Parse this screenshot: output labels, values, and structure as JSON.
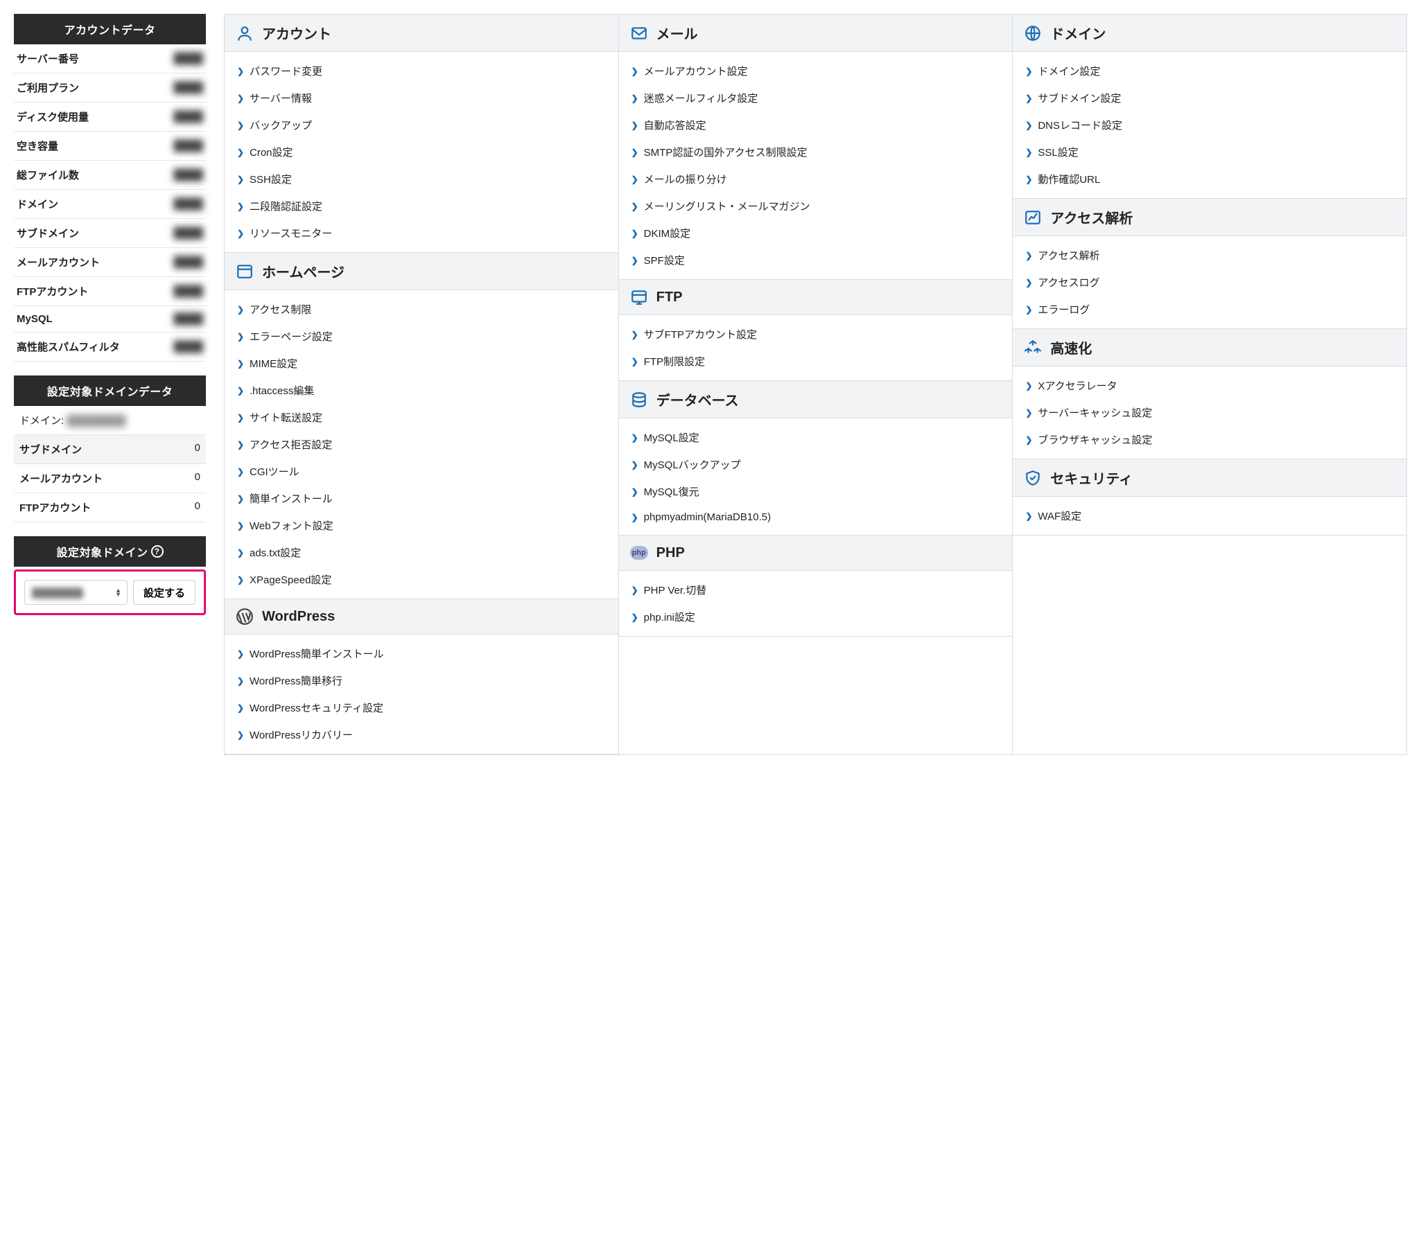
{
  "sidebar": {
    "account_title": "アカウントデータ",
    "stats": [
      {
        "label": "サーバー番号",
        "value": "████"
      },
      {
        "label": "ご利用プラン",
        "value": "████"
      },
      {
        "label": "ディスク使用量",
        "value": "████"
      },
      {
        "label": "空き容量",
        "value": "████"
      },
      {
        "label": "総ファイル数",
        "value": "████"
      },
      {
        "label": "ドメイン",
        "value": "████"
      },
      {
        "label": "サブドメイン",
        "value": "████"
      },
      {
        "label": "メールアカウント",
        "value": "████"
      },
      {
        "label": "FTPアカウント",
        "value": "████"
      },
      {
        "label": "MySQL",
        "value": "████"
      },
      {
        "label": "高性能スパムフィルタ",
        "value": "████"
      }
    ],
    "domain_data_title": "設定対象ドメインデータ",
    "domain_label": "ドメイン:",
    "domain_value": "████████",
    "domain_rows": [
      {
        "label": "サブドメイン",
        "value": "0"
      },
      {
        "label": "メールアカウント",
        "value": "0"
      },
      {
        "label": "FTPアカウント",
        "value": "0"
      }
    ],
    "domain_select_title": "設定対象ドメイン",
    "domain_select_value": "████████",
    "domain_select_button": "設定する"
  },
  "main": {
    "col1": [
      {
        "title": "アカウント",
        "icon": "user",
        "items": [
          "パスワード変更",
          "サーバー情報",
          "バックアップ",
          "Cron設定",
          "SSH設定",
          "二段階認証設定",
          "リソースモニター"
        ]
      },
      {
        "title": "ホームページ",
        "icon": "window",
        "items": [
          "アクセス制限",
          "エラーページ設定",
          "MIME設定",
          ".htaccess編集",
          "サイト転送設定",
          "アクセス拒否設定",
          "CGIツール",
          "簡単インストール",
          "Webフォント設定",
          "ads.txt設定",
          "XPageSpeed設定"
        ]
      },
      {
        "title": "WordPress",
        "icon": "wordpress",
        "items": [
          "WordPress簡単インストール",
          "WordPress簡単移行",
          "WordPressセキュリティ設定",
          "WordPressリカバリー"
        ]
      }
    ],
    "col2": [
      {
        "title": "メール",
        "icon": "mail",
        "items": [
          "メールアカウント設定",
          "迷惑メールフィルタ設定",
          "自動応答設定",
          "SMTP認証の国外アクセス制限設定",
          "メールの振り分け",
          "メーリングリスト・メールマガジン",
          "DKIM設定",
          "SPF設定"
        ]
      },
      {
        "title": "FTP",
        "icon": "ftp",
        "items": [
          "サブFTPアカウント設定",
          "FTP制限設定"
        ]
      },
      {
        "title": "データベース",
        "icon": "database",
        "items": [
          "MySQL設定",
          "MySQLバックアップ",
          "MySQL復元",
          "phpmyadmin(MariaDB10.5)"
        ]
      },
      {
        "title": "PHP",
        "icon": "php",
        "items": [
          "PHP Ver.切替",
          "php.ini設定"
        ]
      }
    ],
    "col3": [
      {
        "title": "ドメイン",
        "icon": "globe",
        "items": [
          "ドメイン設定",
          "サブドメイン設定",
          "DNSレコード設定",
          "SSL設定",
          "動作確認URL"
        ]
      },
      {
        "title": "アクセス解析",
        "icon": "chart",
        "items": [
          "アクセス解析",
          "アクセスログ",
          "エラーログ"
        ]
      },
      {
        "title": "高速化",
        "icon": "speed",
        "items": [
          "Xアクセラレータ",
          "サーバーキャッシュ設定",
          "ブラウザキャッシュ設定"
        ]
      },
      {
        "title": "セキュリティ",
        "icon": "shield",
        "items": [
          "WAF設定"
        ]
      }
    ]
  }
}
